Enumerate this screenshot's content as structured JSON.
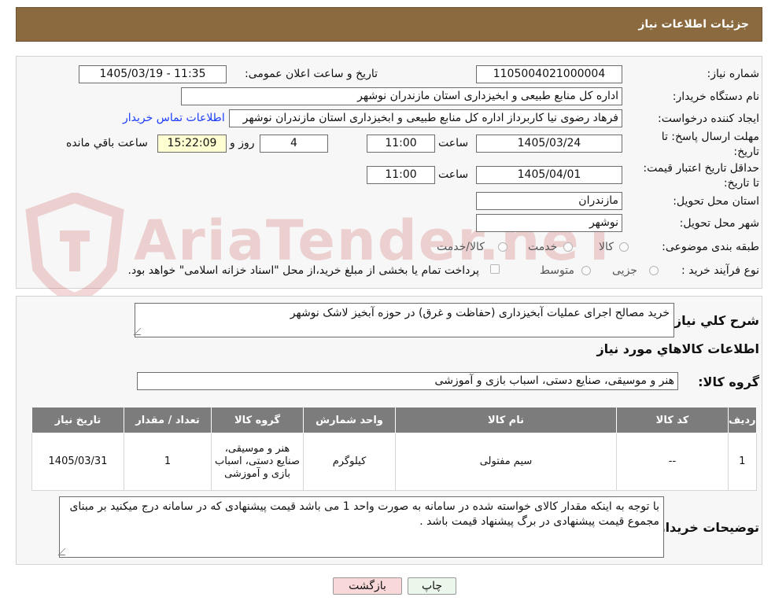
{
  "header": {
    "title": "جزئیات اطلاعات نیاز"
  },
  "form": {
    "need_number_label": "شماره نیاز:",
    "need_number": "1105004021000004",
    "announce_label": "تاریخ و ساعت اعلان عمومی:",
    "announce_value": "1405/03/19 - 11:35",
    "buyer_org_label": "نام دستگاه خریدار:",
    "buyer_org": "اداره کل منابع طبیعی و ابخیزداری استان مازندران  نوشهر",
    "creator_label": "ایجاد کننده درخواست:",
    "creator": "فرهاد رضوی نیا کاربرداز اداره کل منابع طبیعی و ابخیزداری استان مازندران  نوشهر",
    "contact_link": "اطلاعات تماس خریدار",
    "reply_deadline_label": "مهلت ارسال پاسخ: تا تاریخ:",
    "reply_date": "1405/03/24",
    "time_label": "ساعت",
    "reply_time": "11:00",
    "days_value": "4",
    "days_label": "روز و",
    "remaining_time": "15:22:09",
    "remaining_label": "ساعت باقي مانده",
    "price_validity_label": "حداقل تاریخ اعتبار قیمت: تا تاریخ:",
    "price_date": "1405/04/01",
    "price_time": "11:00",
    "province_label": "استان محل تحویل:",
    "province": "مازندران",
    "city_label": "شهر محل تحویل:",
    "city": "نوشهر",
    "category_label": "طبقه بندی موضوعی:",
    "category_options": [
      "کالا",
      "خدمت",
      "کالا/خدمت"
    ],
    "process_label": "نوع فرآیند خرید :",
    "process_options": [
      "جزیی",
      "متوسط"
    ],
    "payment_note": "پرداخت تمام یا بخشی از مبلغ خرید،از محل \"اسناد خزانه اسلامی\" خواهد بود."
  },
  "details": {
    "summary_label": "شرح کلي نياز:",
    "summary": "خرید مصالح اجرای عملیات آبخیزداری (حفاظت و غرق) در حوزه آبخیز لاشک نوشهر",
    "goods_info_title": "اطلاعات کالاهاي مورد نياز",
    "goods_group_label": "گروه کالا:",
    "goods_group": "هنر و موسیقی، صنایع دستی، اسباب بازی و آموزشی",
    "table": {
      "headers": [
        "ردیف",
        "کد کالا",
        "نام کالا",
        "واحد شمارش",
        "گروه کالا",
        "تعداد / مقدار",
        "تاریخ نیاز"
      ],
      "rows": [
        [
          "1",
          "--",
          "سیم مفتولی",
          "کیلوگرم",
          "هنر و موسیقی، صنایع دستی، اسباب بازی و آموزشی",
          "1",
          "1405/03/31"
        ]
      ]
    },
    "buyer_notes_label": "توضیحات خریدار:",
    "buyer_notes": "با توجه به اینکه  مقدار کالای خواسته شده  در سامانه  به صورت واحد 1 می باشد قیمت پیشنهادی که در سامانه درج میکنید بر مبنای مجموع قیمت پیشنهادی در برگ پیشنهاد قیمت باشد ."
  },
  "buttons": {
    "print": "چاپ",
    "back": "بازگشت"
  },
  "watermark": {
    "text": "AriaTender.neT"
  },
  "colors": {
    "header_bg": "#8a6a3e",
    "link": "#1a3cff",
    "back_button_bg": "#f8d8d8",
    "print_button_bg": "#eaf7ea"
  }
}
